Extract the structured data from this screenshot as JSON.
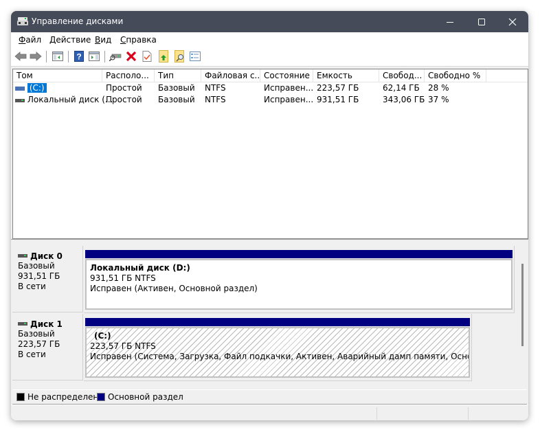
{
  "window": {
    "title": "Управление дисками",
    "controls": {
      "minimize": "minimize",
      "maximize": "maximize",
      "close": "close"
    }
  },
  "menu": {
    "items": [
      {
        "label": "Файл",
        "accel": "Ф",
        "rest": "айл"
      },
      {
        "label": "Действие",
        "accel": "Д",
        "rest": "ействие"
      },
      {
        "label": "Вид",
        "accel": "В",
        "rest": "ид"
      },
      {
        "label": "Справка",
        "accel": "С",
        "rest": "правка"
      }
    ]
  },
  "toolbar": {
    "buttons": [
      "back-icon",
      "forward-icon",
      "show-hide-console-tree-icon",
      "help-icon",
      "show-hide-action-pane-icon",
      "connect-drive-icon",
      "delete-icon",
      "check-icon",
      "folder-up-icon",
      "folder-search-icon",
      "properties-list-icon"
    ]
  },
  "volumes": {
    "columns": [
      "Том",
      "Располо...",
      "Тип",
      "Файловая с...",
      "Состояние",
      "Емкость",
      "Свобод...",
      "Свободно %"
    ],
    "rows": [
      {
        "volume": "(C:)",
        "layout": "Простой",
        "type": "Базовый",
        "fs": "NTFS",
        "status": "Исправен...",
        "capacity": "223,57 ГБ",
        "free": "62,14 ГБ",
        "free_pct": "28 %",
        "selected": true
      },
      {
        "volume": "Локальный диск (...",
        "layout": "Простой",
        "type": "Базовый",
        "fs": "NTFS",
        "status": "Исправен...",
        "capacity": "931,51 ГБ",
        "free": "343,06 ГБ",
        "free_pct": "37 %",
        "selected": false
      }
    ]
  },
  "disks": [
    {
      "name": "Диск 0",
      "type": "Базовый",
      "size": "931,51 ГБ",
      "state": "В сети",
      "partition": {
        "name": "Локальный диск  (D:)",
        "size_fs": "931,51 ГБ NTFS",
        "status": "Исправен (Активен, Основной раздел)",
        "selected": false
      }
    },
    {
      "name": "Диск 1",
      "type": "Базовый",
      "size": "223,57 ГБ",
      "state": "В сети",
      "partition": {
        "name": "(C:)",
        "size_fs": "223,57 ГБ NTFS",
        "status": "Исправен (Система, Загрузка, Файл подкачки, Активен, Аварийный дамп памяти, Основной разде.",
        "selected": true
      }
    }
  ],
  "legend": {
    "items": [
      {
        "label": "Не распределена",
        "color": "#000000"
      },
      {
        "label": "Основной раздел",
        "color": "#000080"
      }
    ]
  },
  "colors": {
    "titlebar": "#454b59",
    "primary_partition": "#000080",
    "selection": "#0078d7"
  }
}
